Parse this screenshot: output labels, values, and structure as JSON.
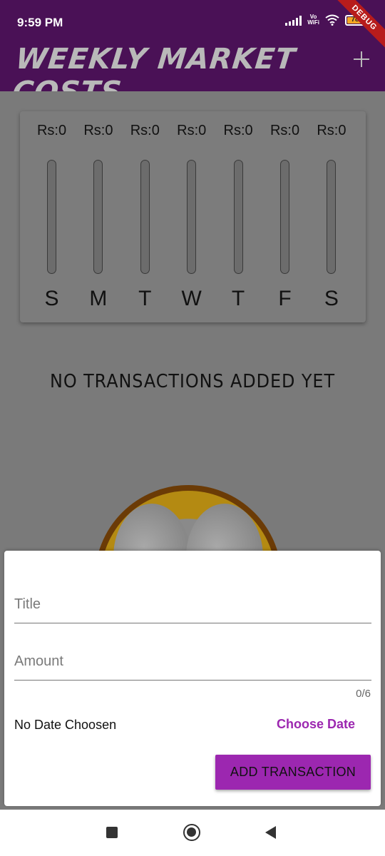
{
  "status_bar": {
    "time": "9:59 PM",
    "vowifi_top": "Vo",
    "vowifi_bottom": "WiFi",
    "battery": "78",
    "debug_label": "DEBUG"
  },
  "app_bar": {
    "title": "WEEKLY MARKET COSTS",
    "add_icon": "plus-icon"
  },
  "chart": {
    "bars": [
      {
        "amount": "Rs:0",
        "day": "S",
        "fill": 0
      },
      {
        "amount": "Rs:0",
        "day": "M",
        "fill": 0
      },
      {
        "amount": "Rs:0",
        "day": "T",
        "fill": 0
      },
      {
        "amount": "Rs:0",
        "day": "W",
        "fill": 0
      },
      {
        "amount": "Rs:0",
        "day": "T",
        "fill": 0
      },
      {
        "amount": "Rs:0",
        "day": "F",
        "fill": 0
      },
      {
        "amount": "Rs:0",
        "day": "S",
        "fill": 0
      }
    ],
    "fill_color": "#4a1156"
  },
  "empty_state": {
    "message": "NO TRANSACTIONS ADDED YET"
  },
  "form": {
    "title_placeholder": "Title",
    "title_value": "",
    "amount_placeholder": "Amount",
    "amount_value": "",
    "amount_counter": "0/6",
    "date_text": "No Date Choosen",
    "choose_date_label": "Choose Date",
    "submit_label": "ADD TRANSACTION",
    "accent_color": "#9c27b0"
  },
  "nav_bar": {
    "icons": [
      "recents-square-icon",
      "home-circle-icon",
      "back-triangle-icon"
    ]
  }
}
